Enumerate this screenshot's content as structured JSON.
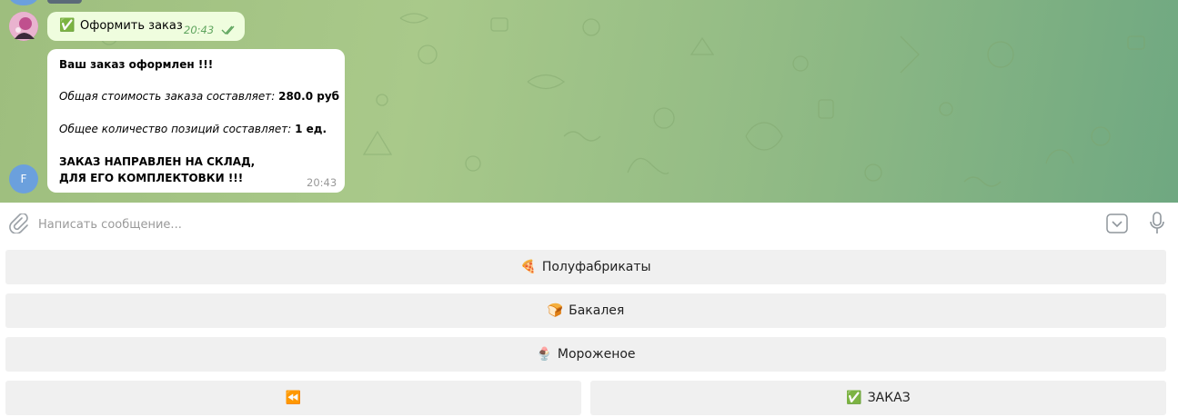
{
  "messages": [
    {
      "kind": "outgoing",
      "emoji": "✅",
      "text": "Оформить заказ",
      "time": "20:43"
    },
    {
      "kind": "incoming",
      "avatar_letter": "F",
      "title": "Ваш заказ оформлен !!!",
      "cost_label": "Общая стоимость заказа составляет:",
      "cost_value": "280.0 руб",
      "qty_label": "Общее количество позиций составляет:",
      "qty_value": "1 ед.",
      "footer_line1": "ЗАКАЗ НАПРАВЛЕН НА СКЛАД,",
      "footer_line2": "ДЛЯ ЕГО КОМПЛЕКТОВКИ !!!",
      "time": "20:43"
    }
  ],
  "composer": {
    "placeholder": "Написать сообщение..."
  },
  "keyboard": {
    "row1": {
      "emoji": "🍕",
      "label": "Полуфабрикаты"
    },
    "row2": {
      "emoji": "🍞",
      "label": "Бакалея"
    },
    "row3": {
      "emoji": "🍨",
      "label": "Мороженое"
    },
    "row4_left": {
      "emoji": "⏪",
      "label": ""
    },
    "row4_right": {
      "emoji": "✅",
      "label": "ЗАКАЗ"
    }
  },
  "colors": {
    "accent_green": "#5fa55e",
    "avatar_blue": "#6ba0dd",
    "button_bg": "#f0f0f0"
  }
}
